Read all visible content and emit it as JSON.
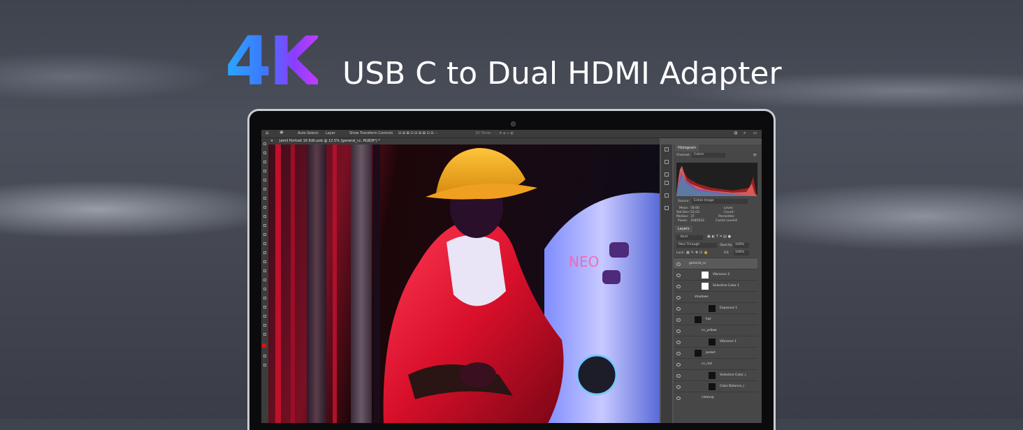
{
  "headline": {
    "badge": "4K",
    "title": "USB C to Dual HDMI Adapter"
  },
  "photoshop": {
    "options_bar": {
      "auto_select": "Auto-Select:",
      "layer_dropdown": "Layer",
      "transform": "Show Transform Controls",
      "mode_3d": "3D Mode:"
    },
    "document_tab": "Jamil Portrait 16 Edit.psb @ 12.5% (general_cc, RGB/8*) *",
    "histogram": {
      "tab": "Histogram",
      "channel_label": "Channel:",
      "channel_value": "Colors",
      "source_label": "Source:",
      "source_value": "Entire Image",
      "stats": {
        "mean_label": "Mean:",
        "mean": "58.66",
        "std_label": "Std Dev:",
        "std": "52.03",
        "median_label": "Median:",
        "median": "37",
        "pixels_label": "Pixels:",
        "pixels": "3585632",
        "level_label": "Level:",
        "count_label": "Count:",
        "percentile_label": "Percentile:",
        "cache_label": "Cache Level:",
        "cache": "4"
      }
    },
    "layers": {
      "tab": "Layers",
      "filter": "Kind",
      "blend_mode": "Pass Through",
      "opacity_label": "Opacity:",
      "opacity": "100%",
      "lock_label": "Lock:",
      "fill_label": "Fill:",
      "fill": "100%",
      "items": [
        {
          "name": "general_cc"
        },
        {
          "name": "Vibrance 2"
        },
        {
          "name": "Selective Color 1"
        },
        {
          "name": "shadows"
        },
        {
          "name": "Exposure 1"
        },
        {
          "name": "hat"
        },
        {
          "name": "cc_yellow"
        },
        {
          "name": "Vibrance 1"
        },
        {
          "name": "jacket"
        },
        {
          "name": "cc_red"
        },
        {
          "name": "Selective Color_r"
        },
        {
          "name": "Color Balance_r"
        },
        {
          "name": "cleanup"
        }
      ]
    }
  },
  "colors": {
    "accent_gradient": [
      "#2aa8ff",
      "#8b3dff",
      "#c23dff"
    ],
    "frame": "#c9ccd3"
  }
}
